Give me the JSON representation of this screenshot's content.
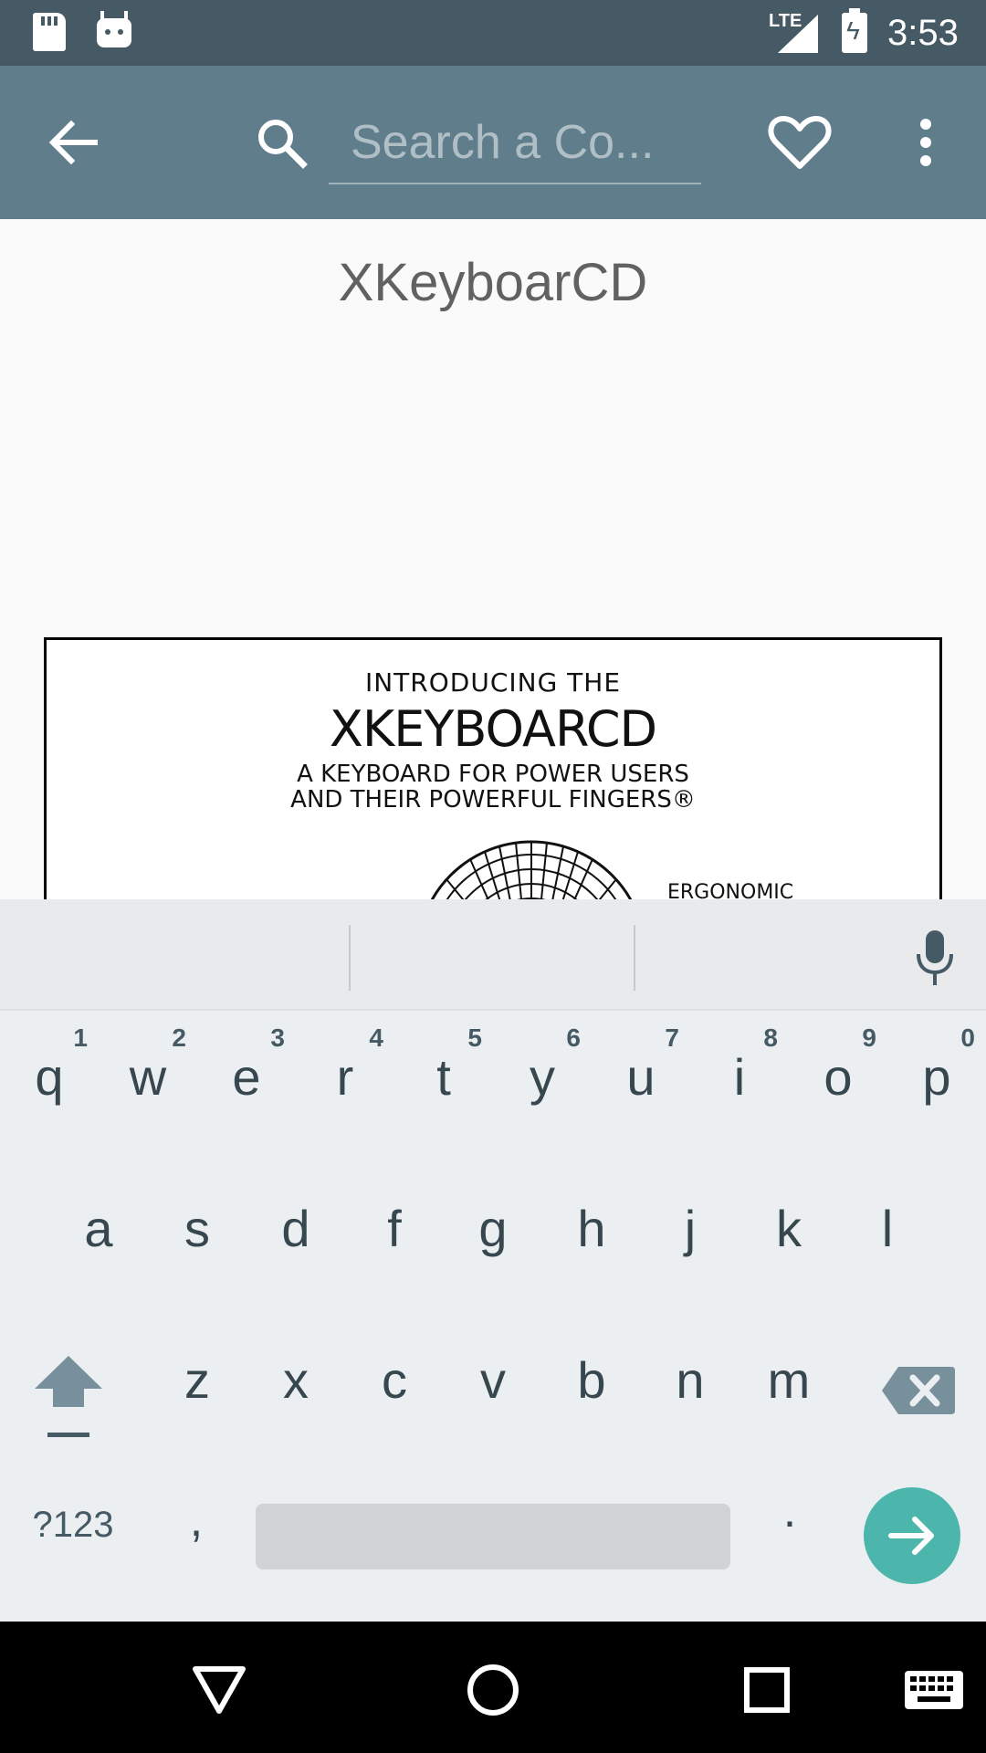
{
  "status_bar": {
    "network": "LTE",
    "time": "3:53"
  },
  "app_bar": {
    "search_placeholder": "Search a Co..."
  },
  "comic": {
    "title": "XKeyboarCD",
    "image_text": {
      "line1": "INTRODUCING THE",
      "line2": "XKEYBOARCD",
      "line3": "A KEYBOARD FOR POWER USERS",
      "line4": "AND THEIR POWERFUL FINGERS®",
      "label": "ERGONOMIC"
    }
  },
  "keyboard": {
    "row1": [
      {
        "char": "q",
        "hint": "1"
      },
      {
        "char": "w",
        "hint": "2"
      },
      {
        "char": "e",
        "hint": "3"
      },
      {
        "char": "r",
        "hint": "4"
      },
      {
        "char": "t",
        "hint": "5"
      },
      {
        "char": "y",
        "hint": "6"
      },
      {
        "char": "u",
        "hint": "7"
      },
      {
        "char": "i",
        "hint": "8"
      },
      {
        "char": "o",
        "hint": "9"
      },
      {
        "char": "p",
        "hint": "0"
      }
    ],
    "row2": [
      "a",
      "s",
      "d",
      "f",
      "g",
      "h",
      "j",
      "k",
      "l"
    ],
    "row3": [
      "z",
      "x",
      "c",
      "v",
      "b",
      "n",
      "m"
    ],
    "symbols_label": "?123",
    "comma": ",",
    "period": "."
  },
  "colors": {
    "status_bar": "#455a64",
    "app_bar": "#607d8b",
    "enter_key": "#4db6ac"
  }
}
